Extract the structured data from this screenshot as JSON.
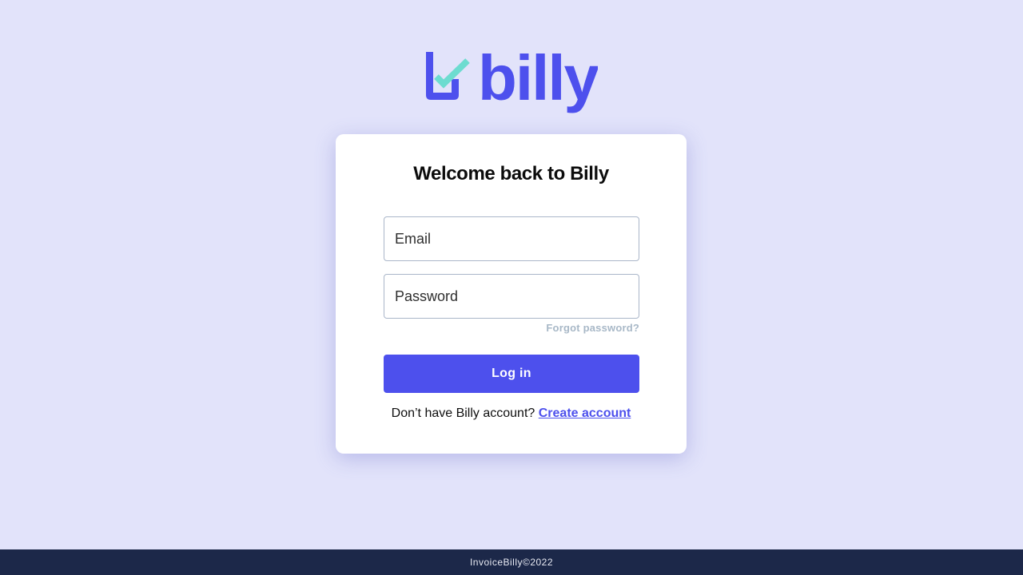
{
  "brand": {
    "name": "billy",
    "primary_color": "#4d50ed",
    "check_color": "#6ddcd0",
    "logo_icon": "checkbox-check-icon"
  },
  "login_card": {
    "title": "Welcome back to Billy",
    "email_placeholder": "Email",
    "password_placeholder": "Password",
    "forgot_password": "Forgot password?",
    "login_button": "Log in",
    "signup_prompt": "Don’t have Billy account?",
    "signup_link": "Create account"
  },
  "footer": {
    "text": "InvoiceBilly©2022"
  }
}
